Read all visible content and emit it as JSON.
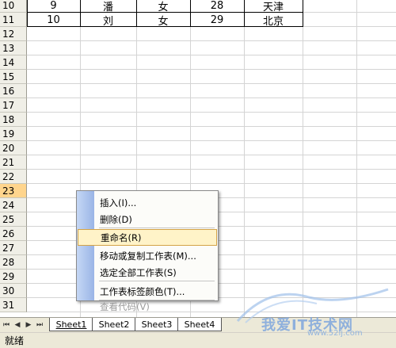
{
  "rows": [
    {
      "num": "10",
      "cells": [
        "9",
        "潘",
        "女",
        "28",
        "天津"
      ]
    },
    {
      "num": "11",
      "cells": [
        "10",
        "刘",
        "女",
        "29",
        "北京"
      ]
    },
    {
      "num": "12",
      "cells": []
    },
    {
      "num": "13",
      "cells": []
    },
    {
      "num": "14",
      "cells": []
    },
    {
      "num": "15",
      "cells": []
    },
    {
      "num": "16",
      "cells": []
    },
    {
      "num": "17",
      "cells": []
    },
    {
      "num": "18",
      "cells": []
    },
    {
      "num": "19",
      "cells": []
    },
    {
      "num": "20",
      "cells": []
    },
    {
      "num": "21",
      "cells": []
    },
    {
      "num": "22",
      "cells": []
    },
    {
      "num": "23",
      "cells": []
    },
    {
      "num": "24",
      "cells": []
    },
    {
      "num": "25",
      "cells": []
    },
    {
      "num": "26",
      "cells": []
    },
    {
      "num": "27",
      "cells": []
    },
    {
      "num": "28",
      "cells": []
    },
    {
      "num": "29",
      "cells": []
    },
    {
      "num": "30",
      "cells": []
    },
    {
      "num": "31",
      "cells": []
    }
  ],
  "selected_row": "23",
  "tabs": [
    "Sheet1",
    "Sheet2",
    "Sheet3",
    "Sheet4"
  ],
  "active_tab": "Sheet1",
  "status_text": "就绪",
  "context_menu": {
    "items": [
      {
        "label": "插入(I)...",
        "highlighted": false,
        "disabled": false
      },
      {
        "label": "删除(D)",
        "highlighted": false,
        "disabled": false
      },
      {
        "label": "重命名(R)",
        "highlighted": true,
        "disabled": false
      },
      {
        "label": "移动或复制工作表(M)...",
        "highlighted": false,
        "disabled": false
      },
      {
        "label": "选定全部工作表(S)",
        "highlighted": false,
        "disabled": false
      },
      {
        "label": "工作表标签颜色(T)...",
        "highlighted": false,
        "disabled": false
      },
      {
        "label": "查看代码(V)",
        "highlighted": false,
        "disabled": true
      }
    ]
  },
  "watermark": {
    "text": "我爱IT技术网",
    "url": "www.52ij.com"
  },
  "colors": {
    "selected_header": "#ffd58d",
    "menu_highlight": "#fff3c8",
    "menu_strip": "#9ab5e6"
  }
}
